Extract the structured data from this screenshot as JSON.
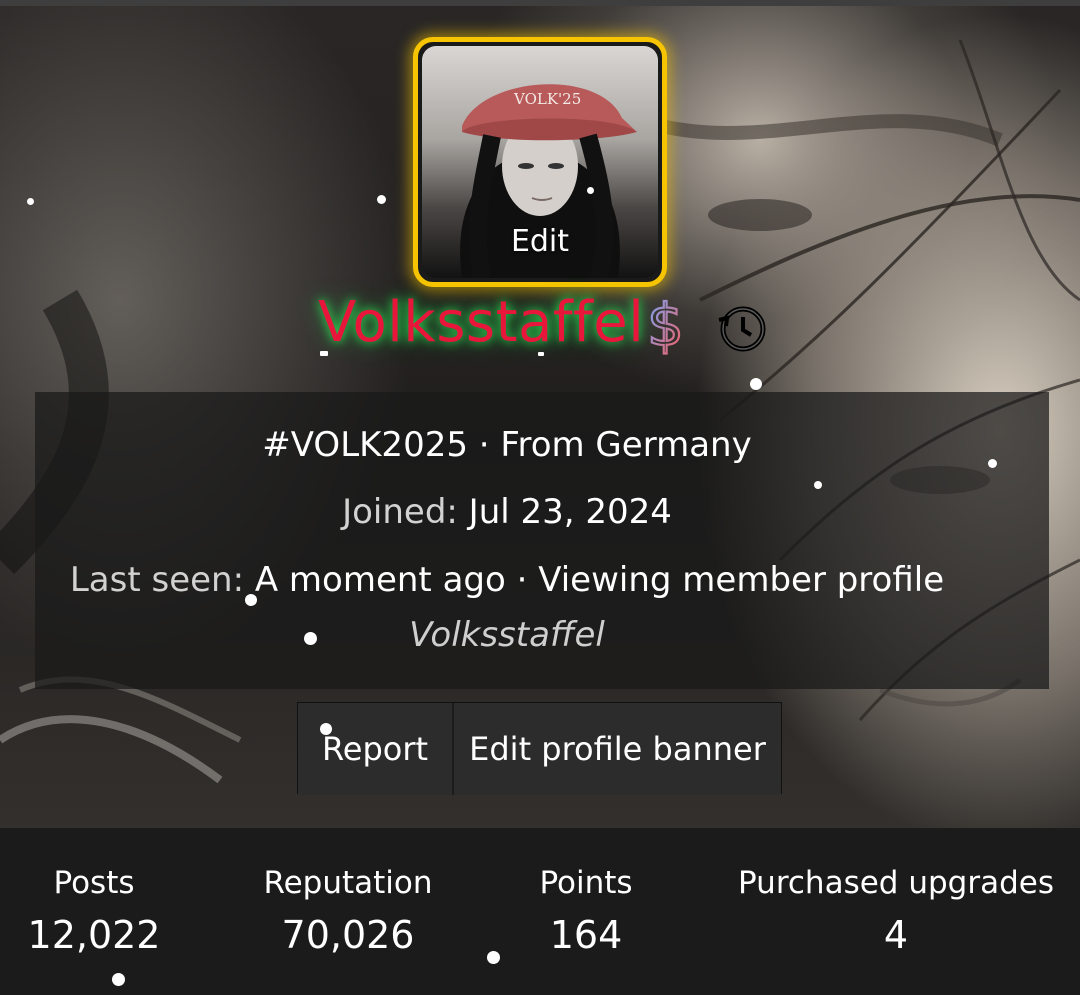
{
  "profile": {
    "avatar_edit_label": "Edit",
    "avatar_cap_text": "VOLK'25",
    "username": "Volksstaffel",
    "username_color": "#e8163b",
    "username_glow_color": "#28ff5a",
    "avatar_border_color": "#f6c400",
    "badges": [
      {
        "icon": "dollar-sign-icon"
      },
      {
        "icon": "history-icon"
      }
    ]
  },
  "info": {
    "tagline": "#VOLK2025 · From Germany",
    "joined_label": "Joined:",
    "joined_value": "Jul 23, 2024",
    "last_seen_label": "Last seen:",
    "last_seen_value": "A moment ago · Viewing member profile",
    "activity_target": "Volksstaffel"
  },
  "actions": {
    "report_label": "Report",
    "edit_banner_label": "Edit profile banner"
  },
  "stats": [
    {
      "label": "Posts",
      "value": "12,022"
    },
    {
      "label": "Reputation",
      "value": "70,026"
    },
    {
      "label": "Points",
      "value": "164"
    },
    {
      "label": "Purchased upgrades",
      "value": "4"
    }
  ]
}
